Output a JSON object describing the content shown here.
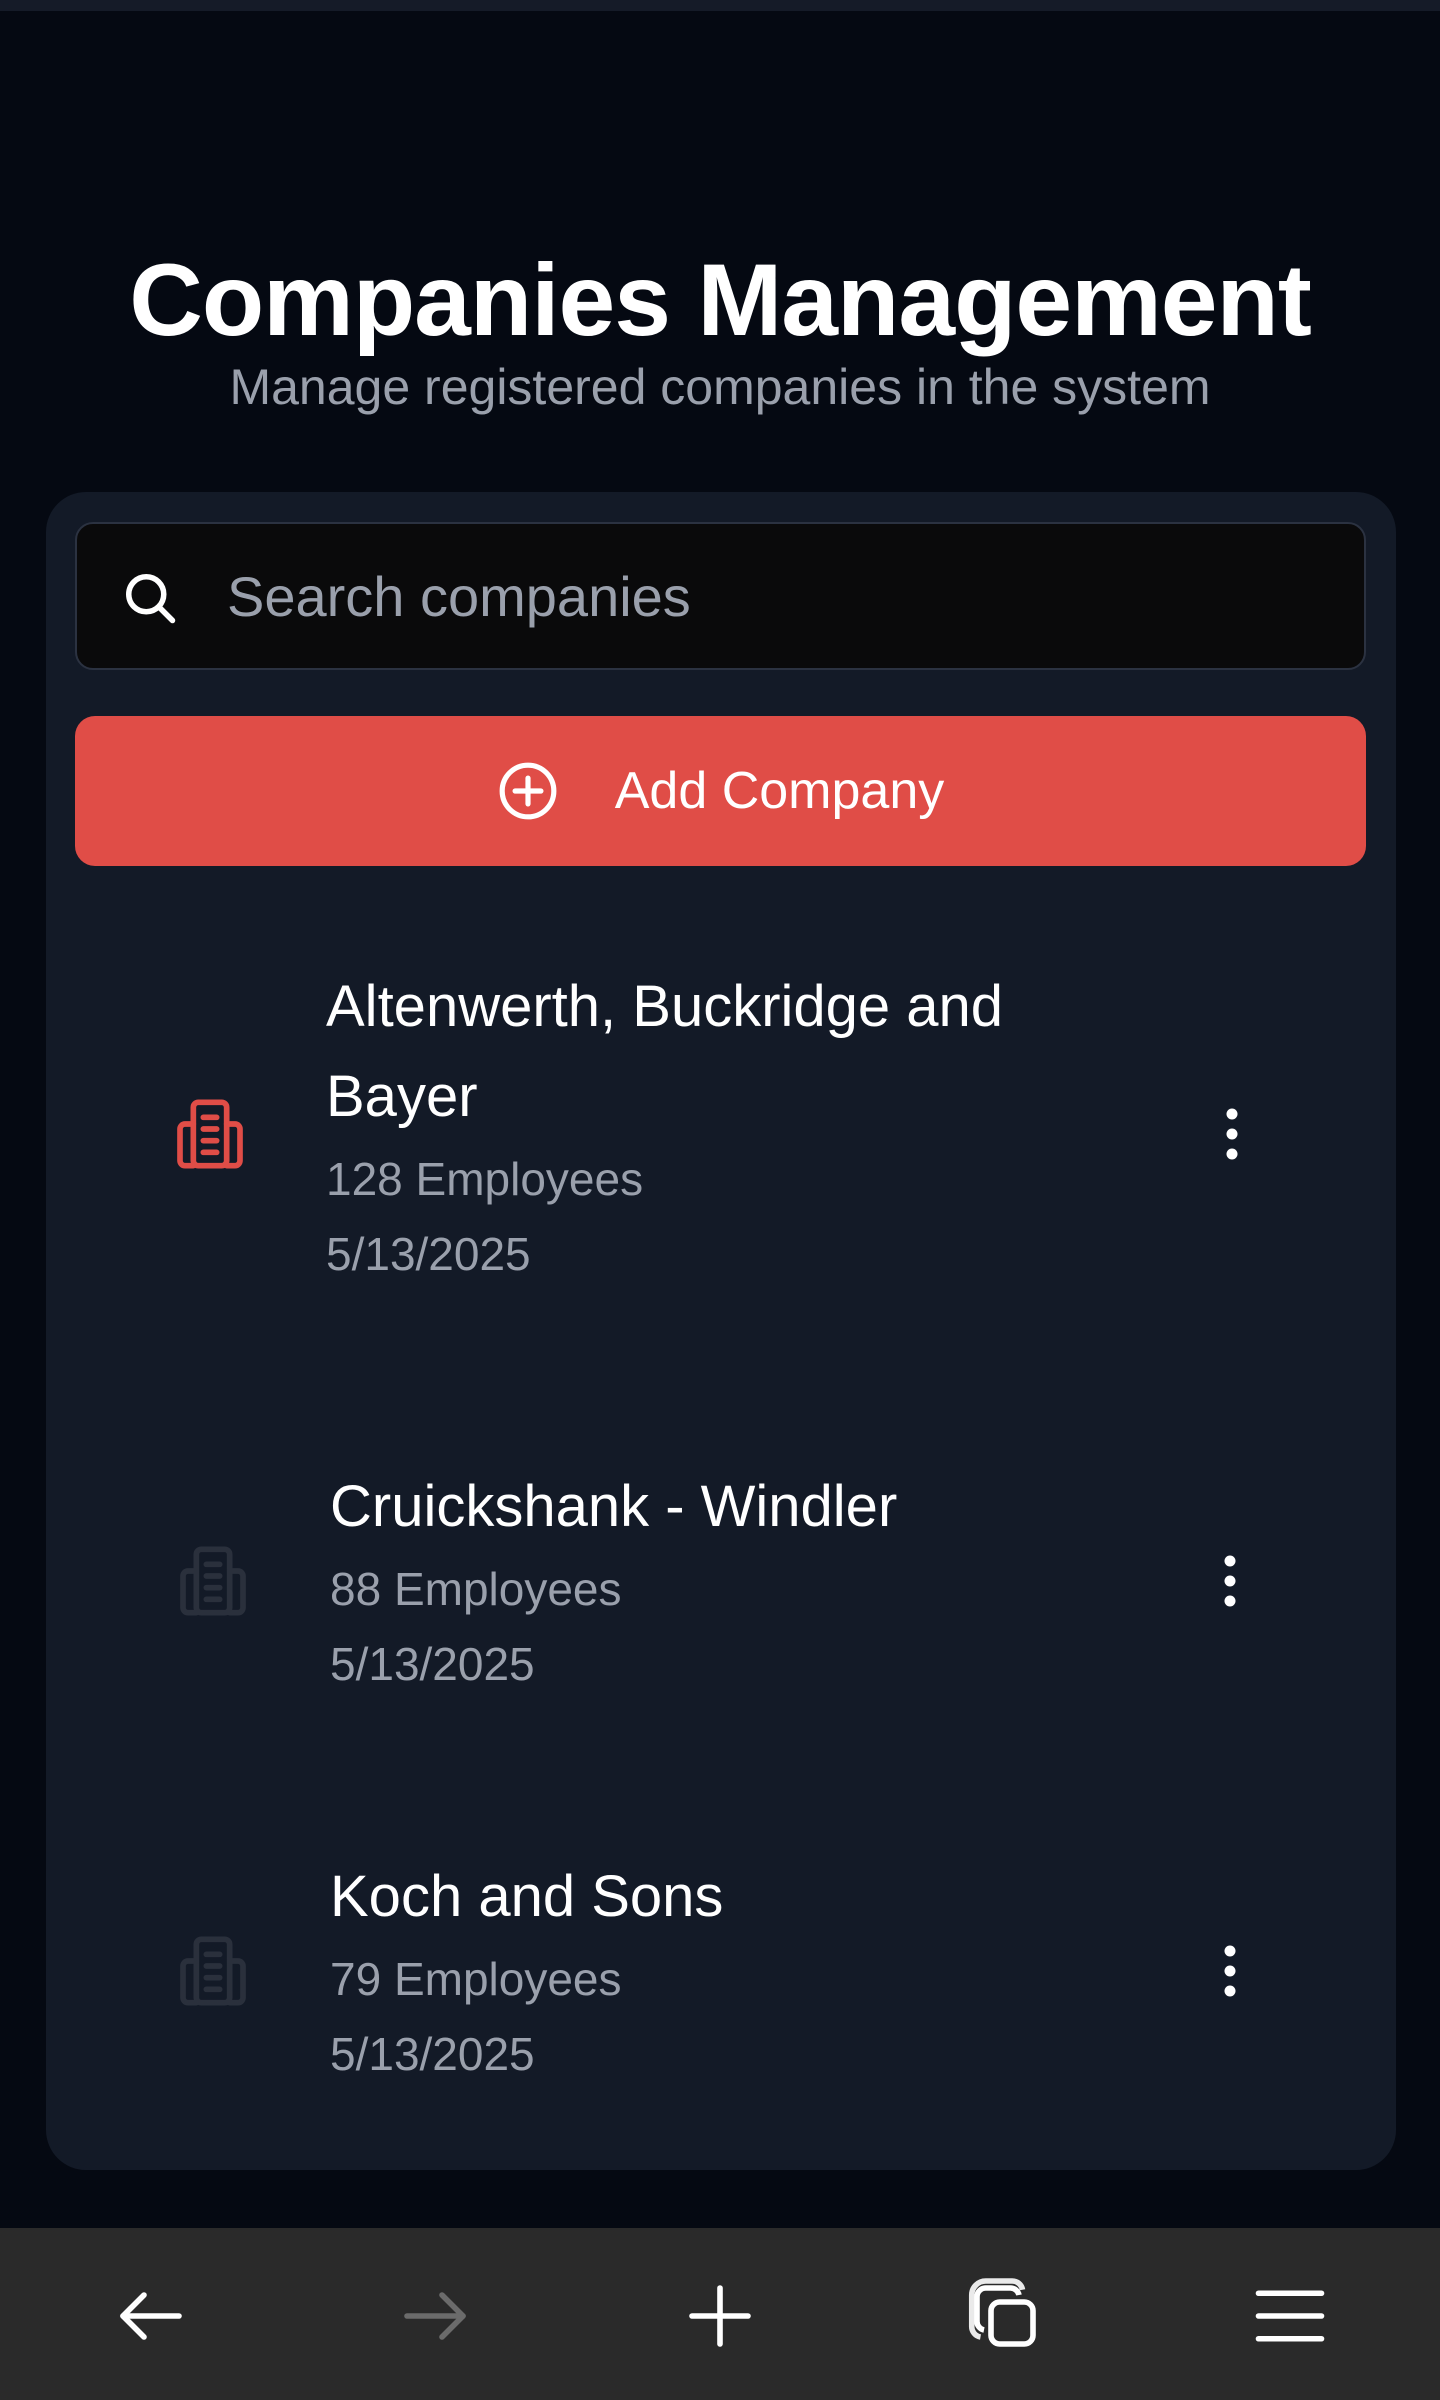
{
  "header": {
    "title": "Companies Management",
    "subtitle": "Manage registered companies in the system"
  },
  "search": {
    "placeholder": "Search companies",
    "value": "",
    "icon": "search-icon"
  },
  "add_button": {
    "label": "Add Company",
    "icon": "plus-circle-icon"
  },
  "companies": [
    {
      "name": "Altenwerth, Buckridge and Bayer",
      "employees": "128 Employees",
      "date": "5/13/2025",
      "icon": "building-icon",
      "active": true
    },
    {
      "name": "Cruickshank - Windler",
      "employees": "88 Employees",
      "date": "5/13/2025",
      "icon": "building-icon",
      "active": false
    },
    {
      "name": "Koch and Sons",
      "employees": "79 Employees",
      "date": "5/13/2025",
      "icon": "building-icon",
      "active": false
    }
  ],
  "bottom_nav": {
    "items": [
      "back-arrow-icon",
      "forward-arrow-icon",
      "new-tab-plus-icon",
      "tabs-icon",
      "menu-icon"
    ]
  },
  "colors": {
    "background": "#050912",
    "card": "#131a27",
    "accent": "#e04d47",
    "muted_icon": "#2a303c",
    "nav_bar": "#2a2a2a"
  }
}
